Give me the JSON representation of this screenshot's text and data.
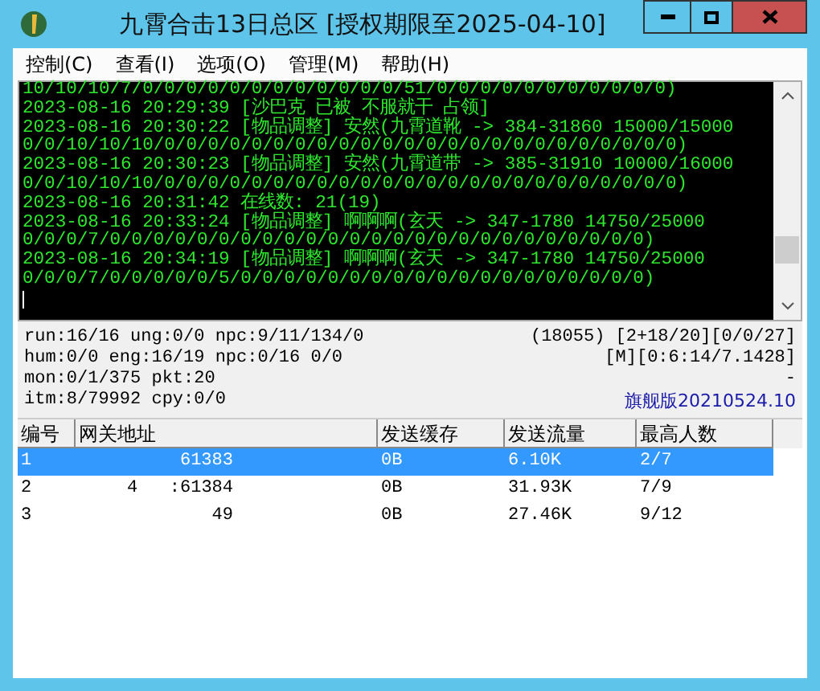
{
  "window": {
    "title": "九霄合击13日总区 [授权期限至2025-04-10]"
  },
  "menu": [
    "控制(C)",
    "查看(I)",
    "选项(O)",
    "管理(M)",
    "帮助(H)"
  ],
  "console": [
    "10/10/10/7/0/0/0/0/0/0/0/0/0/0/0/0/51/0/0/0/0/0/0/0/0/0/0/0)",
    "2023-08-16 20:29:39 [沙巴克 已被 不服就干 占领]",
    "2023-08-16 20:30:22 [物品调整] 安然(九霄道靴 -> 384-31860 15000/15000",
    "0/0/10/10/10/0/0/0/0/0/0/0/0/0/0/0/0/0/0/0/0/0/0/0/0/0/0/0/0)",
    "2023-08-16 20:30:23 [物品调整] 安然(九霄道带 -> 385-31910 10000/16000",
    "0/0/10/10/10/0/0/0/0/0/0/0/0/0/0/0/0/0/0/0/0/0/0/0/0/0/0/0/0)",
    "2023-08-16 20:31:42 在线数: 21(19)",
    "2023-08-16 20:33:24 [物品调整] 啊啊啊(玄天 -> 347-1780 14750/25000",
    "0/0/0/7/0/0/0/0/0/0/0/0/0/0/0/0/0/0/0/0/0/0/0/0/0/0/0/0/0)",
    "2023-08-16 20:34:19 [物品调整] 啊啊啊(玄天 -> 347-1780 14750/25000",
    "0/0/0/7/0/0/0/0/0/5/0/0/0/0/0/0/0/0/0/0/0/0/0/0/0/0/0/0/0)"
  ],
  "status_left": [
    "run:16/16 ung:0/0 npc:9/11/134/0",
    "hum:0/0 eng:16/19 npc:0/16 0/0",
    "mon:0/1/375 pkt:20",
    "itm:8/79992 cpy:0/0"
  ],
  "status_right": [
    "(18055) [2+18/20][0/0/27]",
    "[M][0:6:14/7.1428]",
    "-"
  ],
  "version": "旗舰版20210524.10",
  "table": {
    "columns": [
      "编号",
      "网关地址",
      "发送缓存",
      "发送流量",
      "最高人数"
    ],
    "rows": [
      {
        "cells": [
          "1",
          "61383",
          "0B",
          "6.10K",
          "2/7"
        ],
        "selected": true
      },
      {
        "cells": [
          "2",
          "4   :61384",
          "0B",
          "31.93K",
          "7/9"
        ],
        "selected": false
      },
      {
        "cells": [
          "3",
          "49",
          "0B",
          "27.46K",
          "9/12"
        ],
        "selected": false
      }
    ]
  }
}
